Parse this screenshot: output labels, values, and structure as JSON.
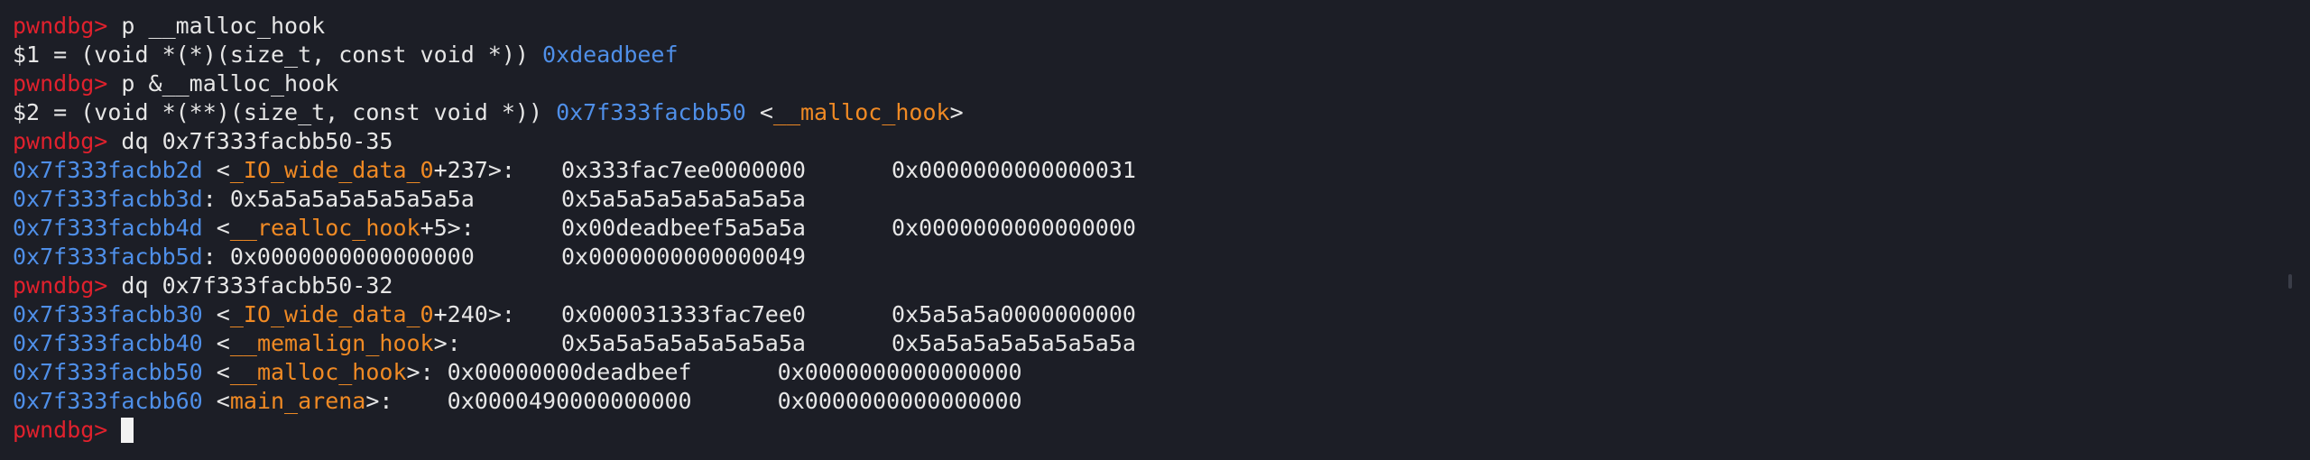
{
  "prompt": "pwndbg>",
  "lines": [
    {
      "kind": "cmd",
      "text": "p __malloc_hook"
    },
    {
      "kind": "result",
      "lhs": "$1 = (void *(*)(size_t, const void *))",
      "addr": "0xdeadbeef"
    },
    {
      "kind": "cmd",
      "text": "p &__malloc_hook"
    },
    {
      "kind": "result_sym",
      "lhs": "$2 = (void *(**)(size_t, const void *))",
      "addr": "0x7f333facbb50",
      "sym": "__malloc_hook"
    },
    {
      "kind": "cmd",
      "text": "dq 0x7f333facbb50-35"
    }
  ],
  "dump1": [
    {
      "addr": "0x7f333facbb2d",
      "sym": "_IO_wide_data_0",
      "offset": "+237",
      "v1": "0x333fac7ee0000000",
      "v2": "0x0000000000000031"
    },
    {
      "addr": "0x7f333facbb3d",
      "sym": "",
      "offset": "",
      "v1": "0x5a5a5a5a5a5a5a5a",
      "v2": "0x5a5a5a5a5a5a5a5a"
    },
    {
      "addr": "0x7f333facbb4d",
      "sym": "__realloc_hook",
      "offset": "+5",
      "v1": "0x00deadbeef5a5a5a",
      "v2": "0x0000000000000000"
    },
    {
      "addr": "0x7f333facbb5d",
      "sym": "",
      "offset": "",
      "v1": "0x0000000000000000",
      "v2": "0x0000000000000049"
    }
  ],
  "cmd2": "dq 0x7f333facbb50-32",
  "dump2": [
    {
      "addr": "0x7f333facbb30",
      "sym": "_IO_wide_data_0",
      "offset": "+240",
      "v1": "0x000031333fac7ee0",
      "v2": "0x5a5a5a0000000000"
    },
    {
      "addr": "0x7f333facbb40",
      "sym": "__memalign_hook",
      "offset": "",
      "v1": "0x5a5a5a5a5a5a5a5a",
      "v2": "0x5a5a5a5a5a5a5a5a"
    }
  ],
  "dump3": [
    {
      "addr": "0x7f333facbb50",
      "sym": "__malloc_hook",
      "v1": "0x00000000deadbeef",
      "v2": "0x0000000000000000"
    },
    {
      "addr": "0x7f333facbb60",
      "sym": "main_arena",
      "v1": "0x0000490000000000",
      "v2": "0x0000000000000000"
    }
  ],
  "colors": {
    "prompt": "#e0212d",
    "address": "#4f8fe8",
    "symbol": "#f08a24",
    "background": "#1c1e26"
  }
}
